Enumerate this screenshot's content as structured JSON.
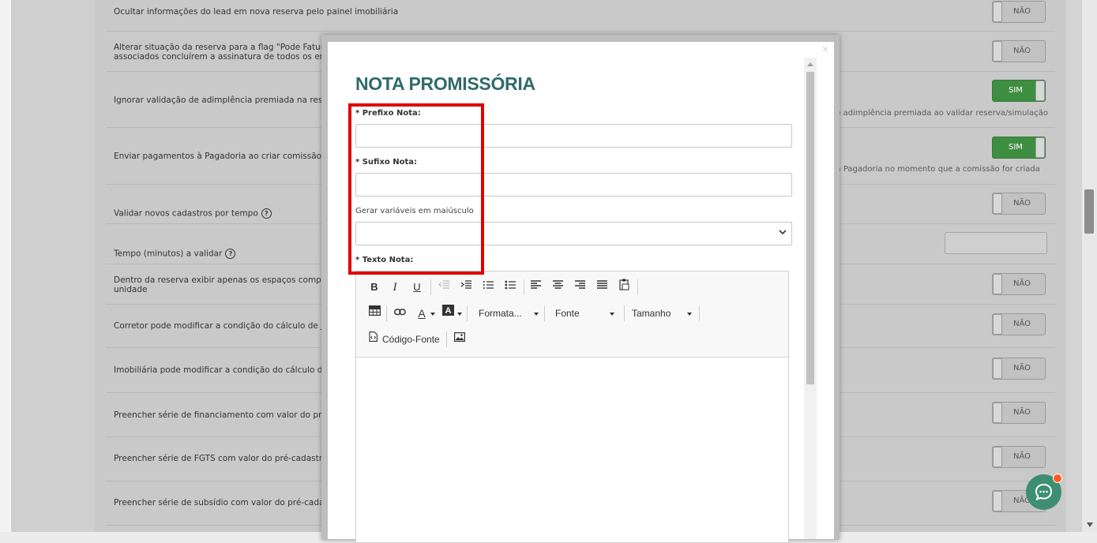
{
  "settings": [
    {
      "label": "Ocultar informações do lead em nova reserva pelo painel imobiliária",
      "toggle": "NÃO",
      "on": false
    },
    {
      "label": "Alterar situação da reserva para a flag \"Pode Faturar\"\nassociados concluírem a assinatura de todos os envel",
      "toggle": "NÃO",
      "on": false
    },
    {
      "label": "Ignorar validação de adimplência premiada na reserva",
      "toggle": "SIM",
      "on": true,
      "hint": "de adimplência premiada ao validar reserva/simulação"
    },
    {
      "label": "Enviar pagamentos à Pagadoria ao criar comissão",
      "toggle": "SIM",
      "on": true,
      "hint": "os à Pagadoria no momento que a comissão for criada"
    },
    {
      "label": "Validar novos cadastros por tempo",
      "toggle": "NÃO",
      "on": false,
      "help": "?"
    },
    {
      "label": "Tempo (minutos) a validar",
      "help": "?"
    },
    {
      "label": "Dentro da reserva exibir apenas os espaços compleme\nunidade",
      "toggle": "NÃO",
      "on": false
    },
    {
      "label": "Corretor pode modificar a condição do cálculo de Juro",
      "toggle": "NÃO",
      "on": false
    },
    {
      "label": "Imobiliária pode modificar a condição do cálculo de Ju",
      "toggle": "NÃO",
      "on": false
    },
    {
      "label": "Preencher série de financiamento com valor do pré-ca",
      "toggle": "NÃO",
      "on": false
    },
    {
      "label": "Preencher série de FGTS com valor do pré-cadastro",
      "toggle": "NÃO",
      "on": false
    },
    {
      "label": "Preencher série de subsídio com valor do pré-cadastro",
      "toggle": "NÃO",
      "on": false
    }
  ],
  "modal": {
    "close": "×",
    "title": "NOTA PROMISSÓRIA",
    "prefix_label": "* Prefixo Nota:",
    "prefix_value": "",
    "suffix_label": "* Sufixo Nota:",
    "suffix_value": "",
    "uppercase_label": "Gerar variáveis em maiúsculo",
    "uppercase_value": "",
    "text_label": "* Texto Nota:",
    "editor": {
      "format_label": "Formata...",
      "font_label": "Fonte",
      "size_label": "Tamanho",
      "source_label": "Código-Fonte",
      "content": ""
    }
  },
  "colors": {
    "accent_green": "#3e8e41",
    "title_teal": "#2f6b6b",
    "highlight_red": "#e00000",
    "chat_green": "#3e8e73",
    "notification_orange": "#ff5a1f"
  },
  "icons": {
    "help": "question-circle-icon",
    "chat": "chat-bubble-icon"
  }
}
